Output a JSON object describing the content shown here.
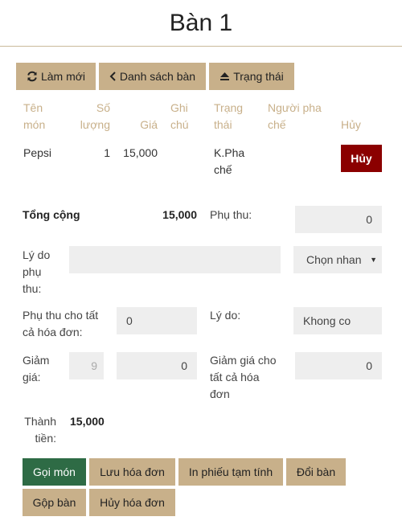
{
  "page": {
    "title": "Bàn 1"
  },
  "toolbar": {
    "refresh_label": "Làm mới",
    "table_list_label": "Danh sách bàn",
    "status_label": "Trạng thái"
  },
  "table": {
    "headers": {
      "name": [
        "Tên",
        "món"
      ],
      "qty": [
        "Số",
        "lượng"
      ],
      "price": "Giá",
      "note": [
        "Ghi",
        "chú"
      ],
      "status": [
        "Trạng",
        "thái"
      ],
      "bartender": [
        "Người pha",
        "chế"
      ],
      "cancel": "Hủy"
    },
    "rows": [
      {
        "name": "Pepsi",
        "qty": "1",
        "price": "15,000",
        "note": "",
        "status": [
          "K.Pha",
          "chế"
        ],
        "bartender": "",
        "cancel_label": "Hủy"
      }
    ]
  },
  "summary": {
    "total_label": "Tổng cộng",
    "total_value": "15,000",
    "surcharge_label": "Phụ thu:",
    "surcharge_value": "0",
    "surcharge_reason_label": [
      "Lý do",
      "phụ",
      "thu:"
    ],
    "surcharge_reason_value": "",
    "surcharge_select_value": "Chọn nhan",
    "surcharge_all_label": [
      "Phụ thu cho tất",
      "cả hóa đơn:"
    ],
    "surcharge_all_value": "0",
    "reason_label": "Lý do:",
    "reason_value": "Khong co",
    "discount_label": [
      "Giảm",
      "giá:"
    ],
    "discount_percent_value": "9",
    "discount_value": "0",
    "discount_all_label": [
      "Giảm giá cho",
      "tất cả hóa",
      "đơn"
    ],
    "discount_all_value": "0",
    "grand_total_label": [
      "Thành",
      "tiền:"
    ],
    "grand_total_value": "15,000"
  },
  "actions": {
    "order_label": "Gọi món",
    "save_label": "Lưu hóa đơn",
    "print_label": "In phiếu tạm tính",
    "change_table_label": "Đổi bàn",
    "merge_table_label": "Gộp bàn",
    "cancel_invoice_label": "Hủy hóa đơn"
  },
  "colors": {
    "accent": "#c8b08a",
    "primary": "#2e6b45",
    "danger": "#8b0000",
    "input_bg": "#eeeeee"
  },
  "icons": {
    "refresh": "refresh-icon",
    "back": "chevron-left-icon",
    "status": "eject-icon",
    "select": "caret-down-icon"
  }
}
